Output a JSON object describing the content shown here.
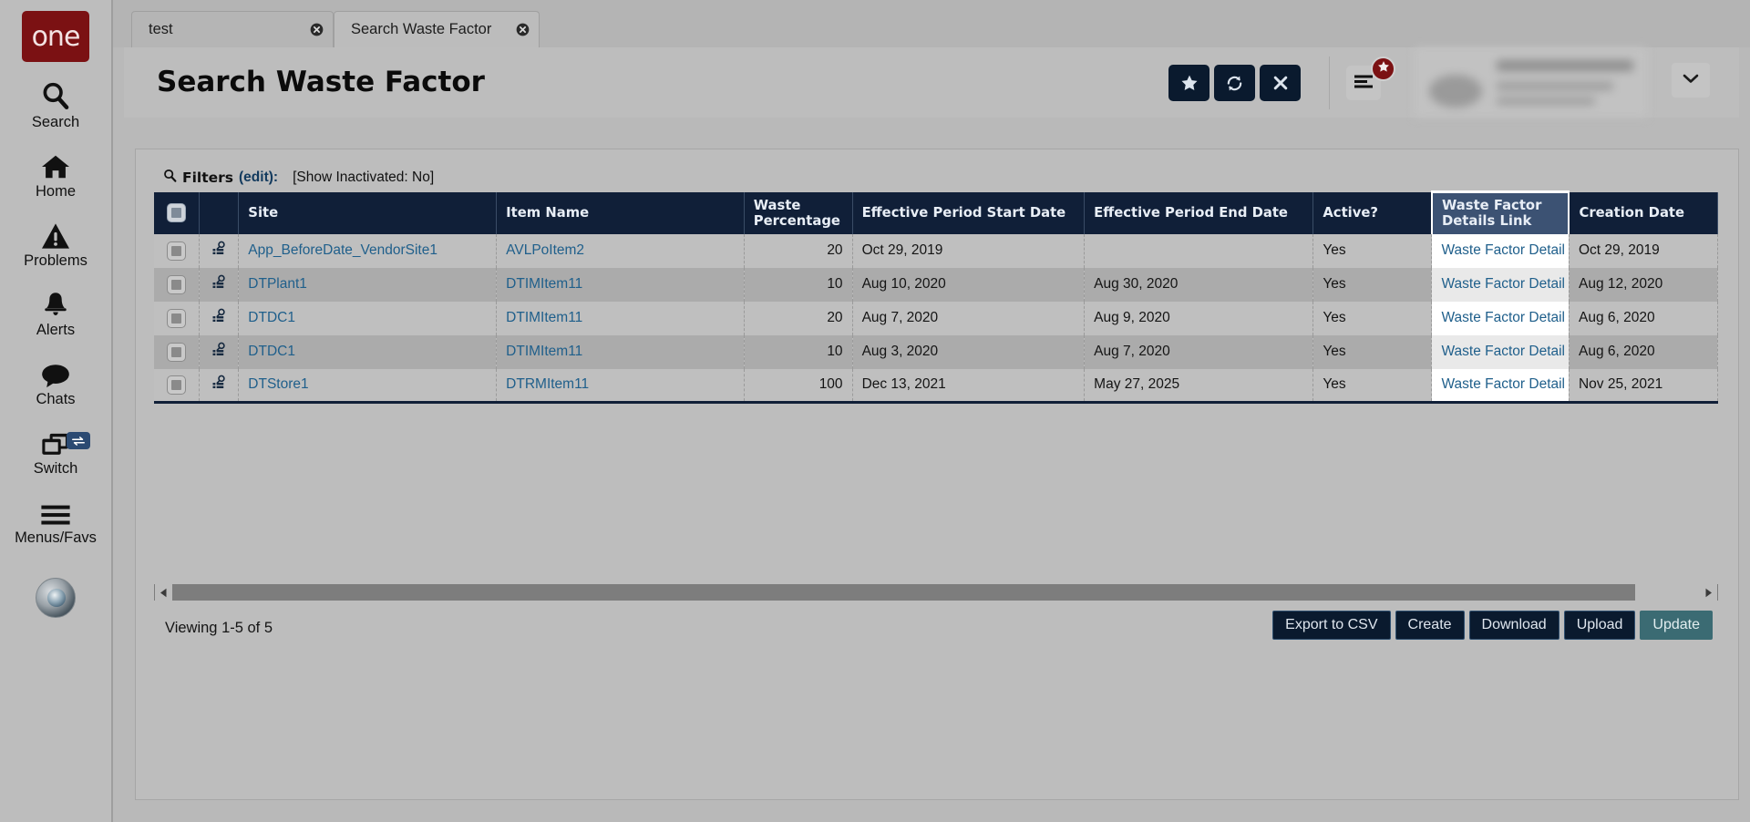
{
  "app": {
    "logo_text": "one"
  },
  "rail": {
    "items": [
      {
        "label": "Search",
        "icon": "search-icon"
      },
      {
        "label": "Home",
        "icon": "home-icon"
      },
      {
        "label": "Problems",
        "icon": "warning-triangle-icon"
      },
      {
        "label": "Alerts",
        "icon": "bell-icon"
      },
      {
        "label": "Chats",
        "icon": "chat-bubble-icon"
      },
      {
        "label": "Switch",
        "icon": "windows-stack-icon",
        "badge_icon": "swap-arrows-icon"
      },
      {
        "label": "Menus/Favs",
        "icon": "hamburger-icon"
      }
    ]
  },
  "tabs": [
    {
      "label": "test",
      "active": false,
      "close_icon": "close-circle-icon"
    },
    {
      "label": "Search Waste Factor",
      "active": true,
      "close_icon": "close-circle-icon"
    }
  ],
  "header": {
    "title": "Search Waste Factor",
    "buttons": [
      {
        "name": "favorite-button",
        "icon": "star-icon"
      },
      {
        "name": "refresh-button",
        "icon": "refresh-icon"
      },
      {
        "name": "close-button",
        "icon": "x-icon"
      }
    ],
    "menus_favs_icon": "hamburger-icon",
    "menus_favs_badge_icon": "star-icon",
    "user_caret_icon": "chevron-down-icon"
  },
  "filters": {
    "icon": "search-icon",
    "label": "Filters",
    "edit_link": "(edit):",
    "state": "[Show Inactivated: No]"
  },
  "table": {
    "select_all_checkbox": true,
    "row_action_icon": "inspect-record-icon",
    "highlighted_column": "Waste Factor Details Link",
    "columns": [
      {
        "key": "site",
        "label": "Site",
        "align": "left"
      },
      {
        "key": "item_name",
        "label": "Item Name",
        "align": "left"
      },
      {
        "key": "waste_percentage",
        "label": "Waste Percentage",
        "align": "right"
      },
      {
        "key": "start_date",
        "label": "Effective Period Start Date",
        "align": "left"
      },
      {
        "key": "end_date",
        "label": "Effective Period End Date",
        "align": "left"
      },
      {
        "key": "active",
        "label": "Active?",
        "align": "left"
      },
      {
        "key": "details_link",
        "label": "Waste Factor Details Link",
        "align": "left"
      },
      {
        "key": "creation_date",
        "label": "Creation Date",
        "align": "left"
      }
    ],
    "rows": [
      {
        "site": "App_BeforeDate_VendorSite1",
        "item_name": "AVLPoItem2",
        "waste_percentage": "20",
        "start_date": "Oct 29, 2019",
        "end_date": "",
        "active": "Yes",
        "details_link": "Waste Factor Detail",
        "creation_date": "Oct 29, 2019"
      },
      {
        "site": "DTPlant1",
        "item_name": "DTIMItem11",
        "waste_percentage": "10",
        "start_date": "Aug 10, 2020",
        "end_date": "Aug 30, 2020",
        "active": "Yes",
        "details_link": "Waste Factor Detail",
        "creation_date": "Aug 12, 2020"
      },
      {
        "site": "DTDC1",
        "item_name": "DTIMItem11",
        "waste_percentage": "20",
        "start_date": "Aug 7, 2020",
        "end_date": "Aug 9, 2020",
        "active": "Yes",
        "details_link": "Waste Factor Detail",
        "creation_date": "Aug 6, 2020"
      },
      {
        "site": "DTDC1",
        "item_name": "DTIMItem11",
        "waste_percentage": "10",
        "start_date": "Aug 3, 2020",
        "end_date": "Aug 7, 2020",
        "active": "Yes",
        "details_link": "Waste Factor Detail",
        "creation_date": "Aug 6, 2020"
      },
      {
        "site": "DTStore1",
        "item_name": "DTRMItem11",
        "waste_percentage": "100",
        "start_date": "Dec 13, 2021",
        "end_date": "May 27, 2025",
        "active": "Yes",
        "details_link": "Waste Factor Detail",
        "creation_date": "Nov 25, 2021"
      }
    ]
  },
  "scrollbar": {
    "left_arrow_icon": "triangle-left-icon",
    "right_arrow_icon": "triangle-right-icon"
  },
  "footer": {
    "viewing": "Viewing 1-5 of 5",
    "buttons": [
      {
        "label": "Export to CSV",
        "primary": false
      },
      {
        "label": "Create",
        "primary": false
      },
      {
        "label": "Download",
        "primary": false
      },
      {
        "label": "Upload",
        "primary": false
      },
      {
        "label": "Update",
        "primary": true
      }
    ]
  },
  "colors": {
    "brand_red": "#7b1113",
    "header_navy": "#101f38",
    "highlight_navy": "#3c5273",
    "link_blue": "#1f5f8b",
    "primary_teal": "#3b6b73",
    "page_gray": "#bdbdbd"
  }
}
